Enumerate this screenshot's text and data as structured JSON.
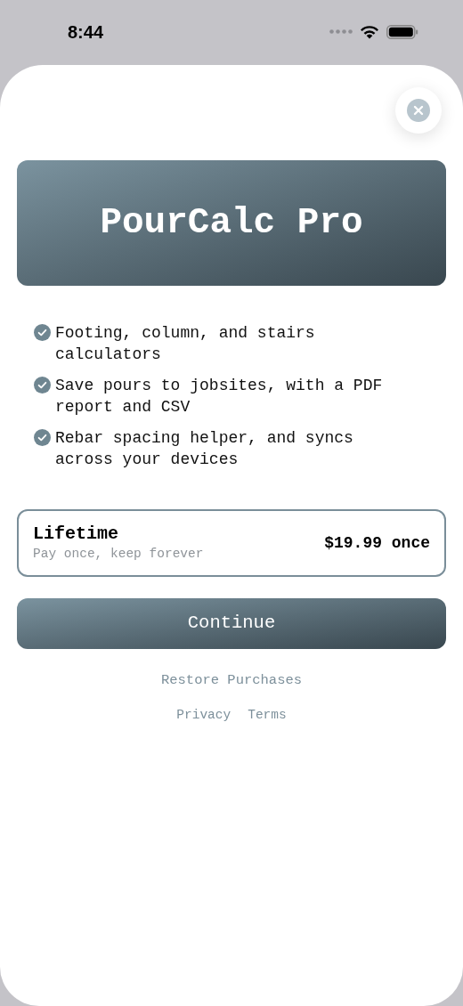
{
  "status_bar": {
    "time": "8:44"
  },
  "banner": {
    "title": "PourCalc Pro"
  },
  "features": [
    {
      "text": "Footing, column, and stairs calculators"
    },
    {
      "text": "Save pours to jobsites, with a PDF report and CSV"
    },
    {
      "text": "Rebar spacing helper, and syncs across your devices"
    }
  ],
  "plan": {
    "name": "Lifetime",
    "subtitle": "Pay once, keep forever",
    "price": "$19.99 once",
    "selected": true
  },
  "continue_button": "Continue",
  "restore_link": "Restore Purchases",
  "footer_links": [
    "Privacy",
    "Terms"
  ]
}
